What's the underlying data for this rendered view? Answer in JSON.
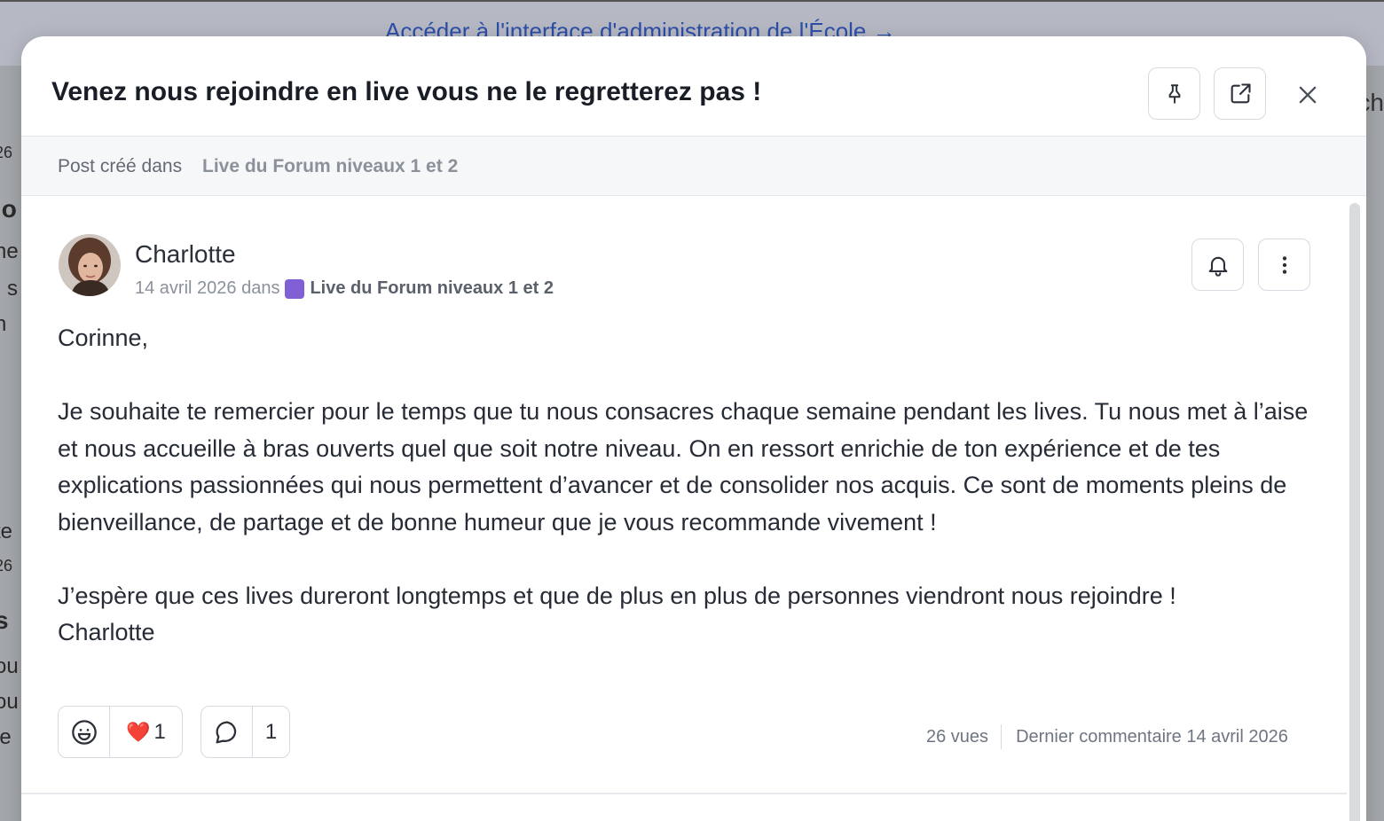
{
  "background": {
    "admin_link": "Accéder à l'interface d'administration de l'École  →",
    "left_fragments": [
      "26",
      "io",
      "ne",
      "s",
      "n",
      "te",
      "26",
      "s",
      "ou",
      "ou",
      "ie"
    ],
    "right_fragment": "ch"
  },
  "modal": {
    "title": "Venez nous rejoindre en live vous ne le regretterez pas !",
    "pin_icon": "pin-icon",
    "open_external_icon": "external-link-icon",
    "close_icon": "close-icon",
    "posted_in_label": "Post créé dans",
    "posted_in_space": "Live du Forum niveaux 1 et 2"
  },
  "post": {
    "author": "Charlotte",
    "date": "14 avril 2026 dans",
    "space": "Live du Forum niveaux 1 et 2",
    "space_color": "#8060d4",
    "paragraphs": [
      "Corinne,",
      "Je souhaite te remercier pour le temps que tu nous consacres chaque semaine pendant les lives. Tu nous met à l’aise et nous accueille à bras ouverts quel que soit notre niveau. On en ressort enrichie de ton expérience et de tes explications passionnées qui nous permettent d’avancer et de consolider nos acquis. Ce sont de moments pleins de bienveillance, de partage et de bonne humeur que je vous recommande vivement !",
      "J’espère que ces lives dureront longtemps et que de plus en plus de personnes viendront nous rejoindre !",
      "Charlotte"
    ],
    "reaction_emoji": "❤️",
    "reaction_count": "1",
    "comment_count": "1",
    "views": "26 vues",
    "last_comment": "Dernier commentaire 14 avril 2026"
  }
}
